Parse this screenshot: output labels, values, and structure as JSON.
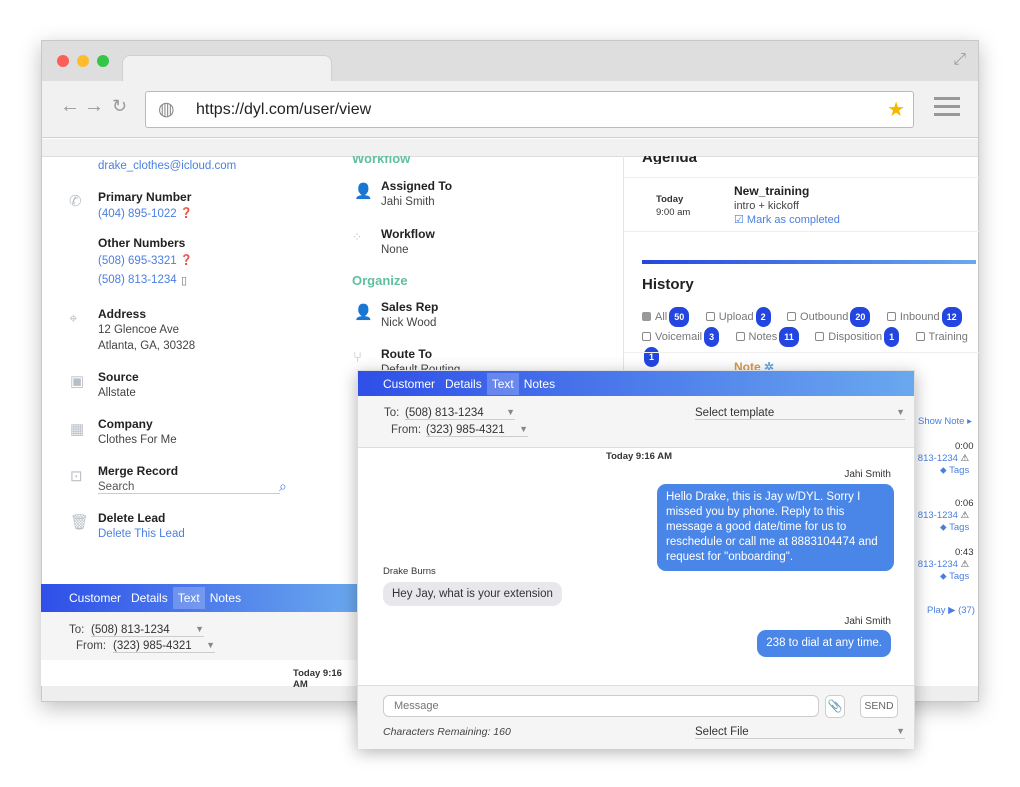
{
  "browser": {
    "url": "https://dyl.com/user/view",
    "colors": {
      "close": "#fc5f57",
      "minimize": "#fdbc2e",
      "maximize": "#33c748"
    }
  },
  "contact": {
    "email": "drake_clothes@icloud.com",
    "primary_label": "Primary Number",
    "primary": "(404) 895-1022",
    "other_label": "Other Numbers",
    "other": [
      "(508) 695-3321",
      "(508) 813-1234"
    ],
    "address_label": "Address",
    "address1": "12 Glencoe Ave",
    "address2": "Atlanta, GA, 30328",
    "source_label": "Source",
    "source": "Allstate",
    "company_label": "Company",
    "company": "Clothes For Me",
    "merge_label": "Merge Record",
    "merge_placeholder": "Search",
    "delete_label": "Delete Lead",
    "delete_link": "Delete This Lead"
  },
  "middle": {
    "workflow_heading": "Workflow",
    "assigned_label": "Assigned To",
    "assigned": "Jahi Smith",
    "workflow_label": "Workflow",
    "workflow": "None",
    "organize_heading": "Organize",
    "salesrep_label": "Sales Rep",
    "salesrep": "Nick Wood",
    "route_label": "Route To",
    "route": "Default Routing"
  },
  "agenda": {
    "heading": "Agenda",
    "day": "Today",
    "time": "9:00 am",
    "title": "New_training",
    "desc": "intro + kickoff",
    "action": "Mark as completed"
  },
  "history": {
    "heading": "History",
    "filters": [
      {
        "label": "All",
        "count": "50",
        "checked": true
      },
      {
        "label": "Upload",
        "count": "2"
      },
      {
        "label": "Outbound",
        "count": "20"
      },
      {
        "label": "Inbound",
        "count": "12"
      },
      {
        "label": "Voicemail",
        "count": "3"
      },
      {
        "label": "Notes",
        "count": "11"
      },
      {
        "label": "Disposition",
        "count": "1"
      },
      {
        "label": "Training",
        "count": "1"
      }
    ],
    "note_label": "Note",
    "show_note": "Show Note",
    "items": [
      {
        "dur": "0:00",
        "num": ") 813-1234",
        "tags": "Tags"
      },
      {
        "dur": "0:06",
        "num": ") 813-1234",
        "tags": "Tags"
      },
      {
        "dur": "0:43",
        "num": ") 813-1234",
        "tags": "Tags"
      }
    ],
    "play": "Play ▶ (37)"
  },
  "tabs": [
    "Customer",
    "Details",
    "Text",
    "Notes"
  ],
  "active_tab": "Text",
  "sms": {
    "to_label": "To:",
    "to": "(508) 813-1234",
    "from_label": "From:",
    "from": "(323) 985-4321",
    "template": "Select template",
    "date": "Today 9:16 AM",
    "messages": [
      {
        "sender": "Jahi Smith",
        "text": "Hello Drake, this is Jay w/DYL. Sorry I missed you by phone. Reply to this message a good date/time for us to reschedule or call me at 8883104474 and request for \"onboarding\".",
        "dir": "out"
      },
      {
        "sender": "Drake Burns",
        "text": "Hey Jay, what is your extension",
        "dir": "in"
      },
      {
        "sender": "Jahi Smith",
        "text": "238 to dial at any time.",
        "dir": "out"
      }
    ],
    "message_placeholder": "Message",
    "send": "SEND",
    "chars": "Characters Remaining: 160",
    "file": "Select File"
  }
}
